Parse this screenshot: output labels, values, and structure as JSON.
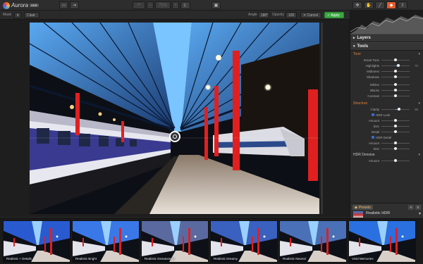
{
  "app": {
    "name": "Aurora",
    "badge": "HDR"
  },
  "toolbar": {
    "zoom_value": "75%",
    "right_tools": [
      "transform-icon",
      "hand-icon",
      "brush-icon",
      "eraser-icon",
      "layers-icon",
      "share-icon"
    ]
  },
  "subbar": {
    "mask_label": "Mask",
    "clear_label": "Clear",
    "angle_label": "Angle",
    "angle_value": "180°",
    "opacity_label": "Opacity",
    "opacity_value": "100",
    "cancel_label": "✕ Cancel",
    "apply_label": "✓ Apply"
  },
  "panel": {
    "layers_title": "Layers",
    "tools_title": "Tools",
    "tone": {
      "title": "Tone",
      "rows": [
        {
          "name": "Smart Tone",
          "pos": 0.5,
          "val": ""
        },
        {
          "name": "Highlights",
          "pos": 0.6,
          "val": "70"
        },
        {
          "name": "Midtones",
          "pos": 0.5,
          "val": ""
        },
        {
          "name": "Shadows",
          "pos": 0.5,
          "val": ""
        },
        {
          "name": "Whites",
          "pos": 0.5,
          "val": ""
        },
        {
          "name": "Blacks",
          "pos": 0.5,
          "val": ""
        },
        {
          "name": "Contrast",
          "pos": 0.5,
          "val": ""
        }
      ]
    },
    "structure": {
      "title": "Structure",
      "clarity": {
        "name": "Clarity",
        "pos": 0.62,
        "val": "58"
      },
      "hdr_look": "HDR Look",
      "hdr_look_rows": [
        {
          "name": "Amount",
          "pos": 0.5,
          "val": ""
        },
        {
          "name": "Size",
          "pos": 0.5,
          "val": ""
        },
        {
          "name": "Detail",
          "pos": 0.5,
          "val": ""
        }
      ],
      "hdr_detail": "HDR Detail",
      "hdr_detail_rows": [
        {
          "name": "Amount",
          "pos": 0.5,
          "val": ""
        },
        {
          "name": "Size",
          "pos": 0.5,
          "val": ""
        }
      ]
    },
    "denoise": {
      "title": "HDR Denoise",
      "rows": [
        {
          "name": "Amount",
          "pos": 0.5,
          "val": ""
        }
      ]
    },
    "presets_label": "Presets",
    "current_preset": "Realistic HDR"
  },
  "presets": [
    "Realistic + Details",
    "Realistic Bright",
    "Realistic Desaturated",
    "Realistic Dreamy",
    "Realistic Neutral",
    "Vivid Memories"
  ]
}
